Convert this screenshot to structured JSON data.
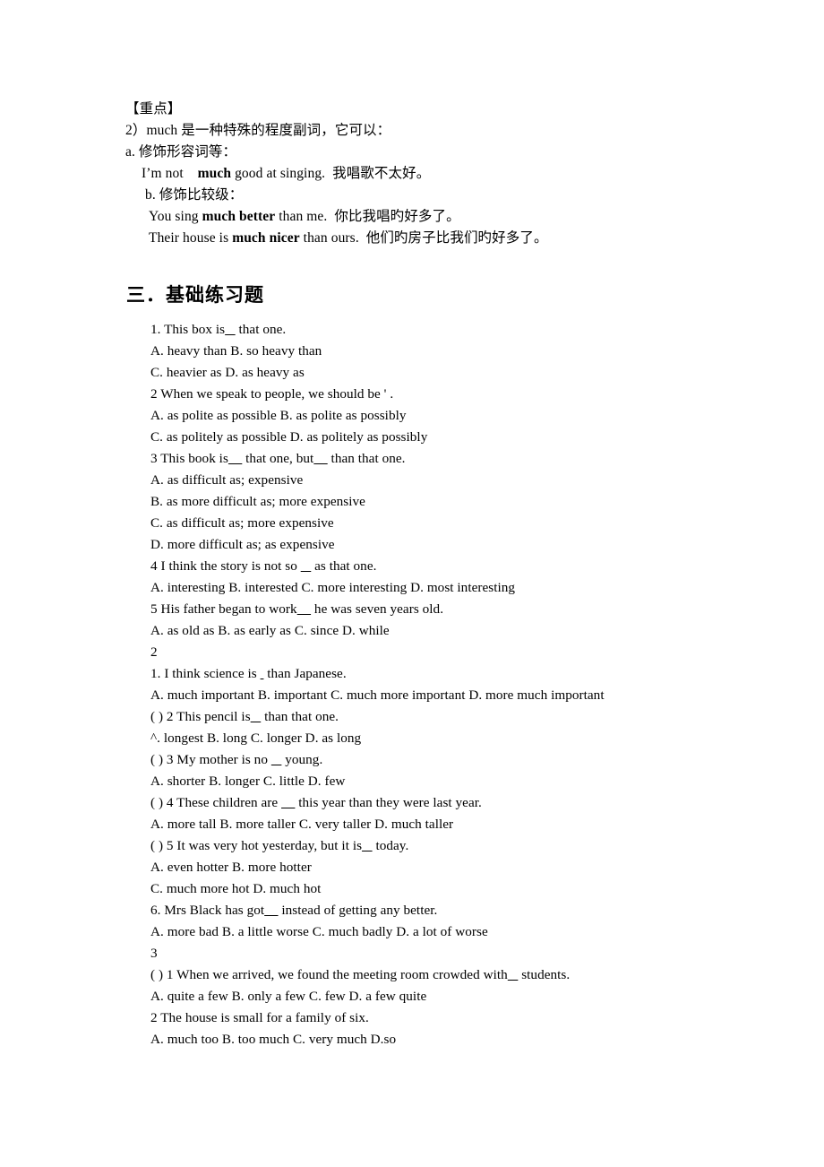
{
  "document": {
    "notes": {
      "heading_label": "【重点】",
      "lines": [
        {
          "indent": 1,
          "segments": [
            {
              "text": "2）much 是一种特殊的程度副词，它可以：",
              "bold": false
            }
          ]
        },
        {
          "indent": 1,
          "segments": [
            {
              "text": "a. 修饰形容词等：",
              "bold": false
            }
          ]
        },
        {
          "indent": 2,
          "segments": [
            {
              "text": "I’m not    ",
              "bold": false
            },
            {
              "text": "much",
              "bold": true
            },
            {
              "text": " good at singing.  我唱歌不太好。",
              "bold": false
            }
          ]
        },
        {
          "indent": 2,
          "segments": [
            {
              "text": " b. 修饰比较级：",
              "bold": false
            }
          ]
        },
        {
          "indent": 3,
          "segments": [
            {
              "text": "You sing ",
              "bold": false
            },
            {
              "text": "much better",
              "bold": true
            },
            {
              "text": " than me.  你比我唱旳好多了。",
              "bold": false
            }
          ]
        },
        {
          "indent": 3,
          "segments": [
            {
              "text": "Their house is ",
              "bold": false
            },
            {
              "text": "much nicer",
              "bold": true
            },
            {
              "text": " than ours.  他们旳房子比我们旳好多了。",
              "bold": false
            }
          ]
        }
      ]
    },
    "section": {
      "heading": "三．基础练习题"
    },
    "exercises": [
      "1. This box is___ that one.",
      "A. heavy than B. so heavy than",
      "C. heavier as D. as heavy as",
      "2 When we speak to people, we should be ' .",
      "A. as polite as possible B. as polite as possibly",
      "C. as politely as possible D. as politely as possibly",
      "3 This book is____ that one, but____ than that one.",
      "A. as difficult as; expensive",
      "B. as more difficult as; more expensive",
      "C. as difficult as; more expensive",
      "D. more difficult as; as expensive",
      "4 I think the story is not so ___ as that one.",
      "A. interesting B. interested C. more interesting D. most interesting",
      "5 His father began to work____ he was seven years old.",
      "A. as old as B. as early as C. since D. while",
      "2",
      "1. I think science is _ than Japanese.",
      "A. much important B. important C. much more important D. more much important",
      "( ) 2 This pencil is___ than that one.",
      "^. longest B. long C. longer D. as long",
      "( ) 3 My mother is no ___ young.",
      "A. shorter B. longer C. little D. few",
      "( ) 4 These children are ____ this year than they were last year.",
      "A. more tall B. more taller C. very taller D. much taller",
      "( ) 5 It was very hot yesterday, but it is___ today.",
      "A. even hotter B. more hotter",
      "C. much more hot D. much hot",
      "6. Mrs Black has got____ instead of getting any better.",
      "A. more bad B. a little worse C. much badly D. a lot of worse",
      "3",
      "( ) 1 When we arrived, we found the meeting room crowded with___ students.",
      "A. quite a few B. only a few C. few D. a few quite",
      "2 The house is small for a family of six.",
      "A. much too B. too much C. very much D.so"
    ]
  }
}
